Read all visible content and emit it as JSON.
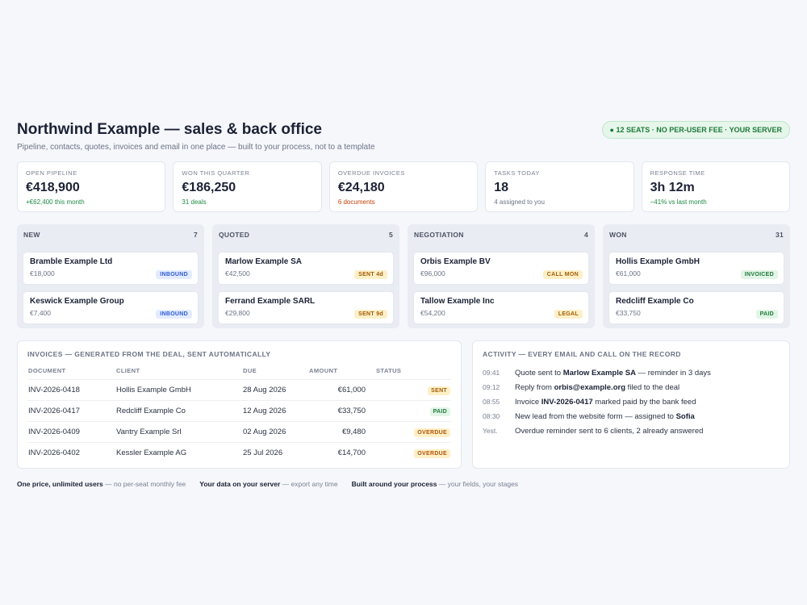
{
  "header": {
    "title": "Northwind Example — sales & back office",
    "subtitle": "Pipeline, contacts, quotes, invoices and email in one place — built to your process, not to a template",
    "badge": "● 12 SEATS · NO PER-USER FEE · YOUR SERVER"
  },
  "stats": [
    {
      "label": "OPEN PIPELINE",
      "value": "€418,900",
      "note": "+€62,400 this month",
      "tone": "green"
    },
    {
      "label": "WON THIS QUARTER",
      "value": "€186,250",
      "note": "31 deals",
      "tone": "green"
    },
    {
      "label": "OVERDUE INVOICES",
      "value": "€24,180",
      "note": "6 documents",
      "tone": "orange"
    },
    {
      "label": "TASKS TODAY",
      "value": "18",
      "note": "4 assigned to you",
      "tone": "gray"
    },
    {
      "label": "RESPONSE TIME",
      "value": "3h 12m",
      "note": "−41% vs last month",
      "tone": "green"
    }
  ],
  "board": [
    {
      "name": "NEW",
      "count": "7",
      "cards": [
        {
          "name": "Bramble Example Ltd",
          "amount": "€18,000",
          "tag": "INBOUND",
          "tone": "blue"
        },
        {
          "name": "Keswick Example Group",
          "amount": "€7,400",
          "tag": "INBOUND",
          "tone": "blue"
        }
      ]
    },
    {
      "name": "QUOTED",
      "count": "5",
      "cards": [
        {
          "name": "Marlow Example SA",
          "amount": "€42,500",
          "tag": "SENT 4d",
          "tone": "amber"
        },
        {
          "name": "Ferrand Example SARL",
          "amount": "€29,800",
          "tag": "SENT 9d",
          "tone": "amber"
        }
      ]
    },
    {
      "name": "NEGOTIATION",
      "count": "4",
      "cards": [
        {
          "name": "Orbis Example BV",
          "amount": "€96,000",
          "tag": "CALL MON",
          "tone": "amber"
        },
        {
          "name": "Tallow Example Inc",
          "amount": "€54,200",
          "tag": "LEGAL",
          "tone": "amber"
        }
      ]
    },
    {
      "name": "WON",
      "count": "31",
      "cards": [
        {
          "name": "Hollis Example GmbH",
          "amount": "€61,000",
          "tag": "INVOICED",
          "tone": "green"
        },
        {
          "name": "Redcliff Example Co",
          "amount": "€33,750",
          "tag": "PAID",
          "tone": "green"
        }
      ]
    }
  ],
  "invoices": {
    "title": "INVOICES — GENERATED FROM THE DEAL, SENT AUTOMATICALLY",
    "columns": [
      "DOCUMENT",
      "CLIENT",
      "DUE",
      "AMOUNT",
      "STATUS"
    ],
    "rows": [
      {
        "doc": "INV-2026-0418",
        "client": "Hollis Example GmbH",
        "due": "28 Aug 2026",
        "amount": "€61,000",
        "status": "SENT",
        "tone": "sent"
      },
      {
        "doc": "INV-2026-0417",
        "client": "Redcliff Example Co",
        "due": "12 Aug 2026",
        "amount": "€33,750",
        "status": "PAID",
        "tone": "paid"
      },
      {
        "doc": "INV-2026-0409",
        "client": "Vantry Example Srl",
        "due": "02 Aug 2026",
        "amount": "€9,480",
        "status": "OVERDUE",
        "tone": "overdue"
      },
      {
        "doc": "INV-2026-0402",
        "client": "Kessler Example AG",
        "due": "25 Jul 2026",
        "amount": "€14,700",
        "status": "OVERDUE",
        "tone": "overdue"
      }
    ]
  },
  "activity": {
    "title": "ACTIVITY — EVERY EMAIL AND CALL ON THE RECORD",
    "items": [
      {
        "time": "09:41",
        "pre": "Quote sent to ",
        "bold": "Marlow Example SA",
        "post": " — reminder in 3 days"
      },
      {
        "time": "09:12",
        "pre": "Reply from ",
        "bold": "orbis@example.org",
        "post": " filed to the deal"
      },
      {
        "time": "08:55",
        "pre": "Invoice ",
        "bold": "INV-2026-0417",
        "post": " marked paid by the bank feed"
      },
      {
        "time": "08:30",
        "pre": "New lead from the website form — assigned to ",
        "bold": "Sofia",
        "post": ""
      },
      {
        "time": "Yest.",
        "pre": "Overdue reminder sent to 6 clients, 2 already answered",
        "bold": "",
        "post": ""
      }
    ]
  },
  "footer": [
    {
      "bold": "One price, unlimited users",
      "rest": " — no per-seat monthly fee"
    },
    {
      "bold": "Your data on your server",
      "rest": " — export any time"
    },
    {
      "bold": "Built around your process",
      "rest": " — your fields, your stages"
    }
  ]
}
